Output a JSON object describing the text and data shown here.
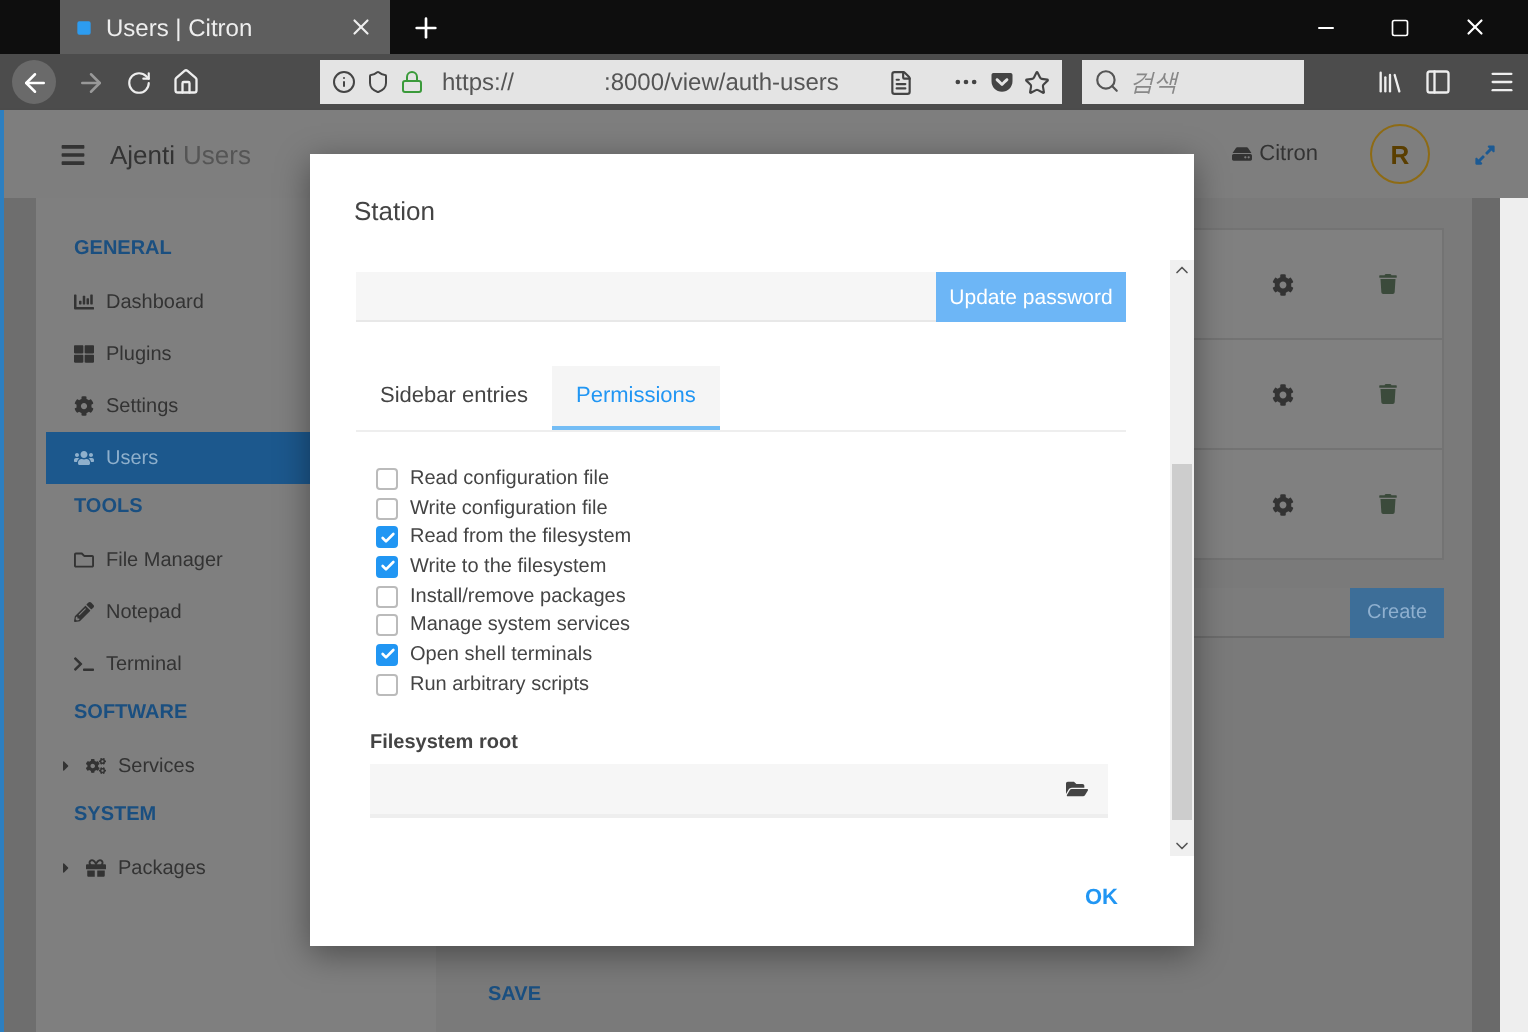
{
  "browser": {
    "tab": {
      "title": "Users | Citron"
    },
    "url": {
      "scheme": "https://",
      "path": ":8000/view/auth-users"
    },
    "search": {
      "placeholder": "검색"
    }
  },
  "header": {
    "brand": "Ajenti",
    "page": "Users",
    "server": "Citron",
    "avatar": "R"
  },
  "sidebar": {
    "sections": [
      {
        "title": "GENERAL",
        "items": [
          {
            "label": "Dashboard",
            "kind": "link",
            "selected": false
          },
          {
            "label": "Plugins",
            "kind": "link",
            "selected": false
          },
          {
            "label": "Settings",
            "kind": "link",
            "selected": false
          },
          {
            "label": "Users",
            "kind": "link",
            "selected": true
          }
        ]
      },
      {
        "title": "TOOLS",
        "items": [
          {
            "label": "File Manager",
            "kind": "link",
            "selected": false
          },
          {
            "label": "Notepad",
            "kind": "link",
            "selected": false
          },
          {
            "label": "Terminal",
            "kind": "link",
            "selected": false
          }
        ]
      },
      {
        "title": "SOFTWARE",
        "items": [
          {
            "label": "Services",
            "kind": "group",
            "selected": false
          }
        ]
      },
      {
        "title": "SYSTEM",
        "items": [
          {
            "label": "Packages",
            "kind": "group",
            "selected": false
          }
        ]
      }
    ]
  },
  "users": {
    "rows": [
      {
        "kind": "user"
      },
      {
        "kind": "user"
      },
      {
        "kind": "user"
      }
    ],
    "create_button": "Create",
    "save_button": "SAVE"
  },
  "dialog": {
    "title": "Station",
    "password_button": "Update password",
    "tabs": [
      {
        "label": "Sidebar entries",
        "selected": false
      },
      {
        "label": "Permissions",
        "selected": true
      }
    ],
    "permissions": [
      {
        "label": "Read configuration file",
        "checked": false
      },
      {
        "label": "Write configuration file",
        "checked": false
      },
      {
        "label": "Read from the filesystem",
        "checked": true
      },
      {
        "label": "Write to the filesystem",
        "checked": true
      },
      {
        "label": "Install/remove packages",
        "checked": false
      },
      {
        "label": "Manage system services",
        "checked": false
      },
      {
        "label": "Open shell terminals",
        "checked": true
      },
      {
        "label": "Run arbitrary scripts",
        "checked": false
      }
    ],
    "root_label": "Filesystem root",
    "ok_button": "OK"
  }
}
